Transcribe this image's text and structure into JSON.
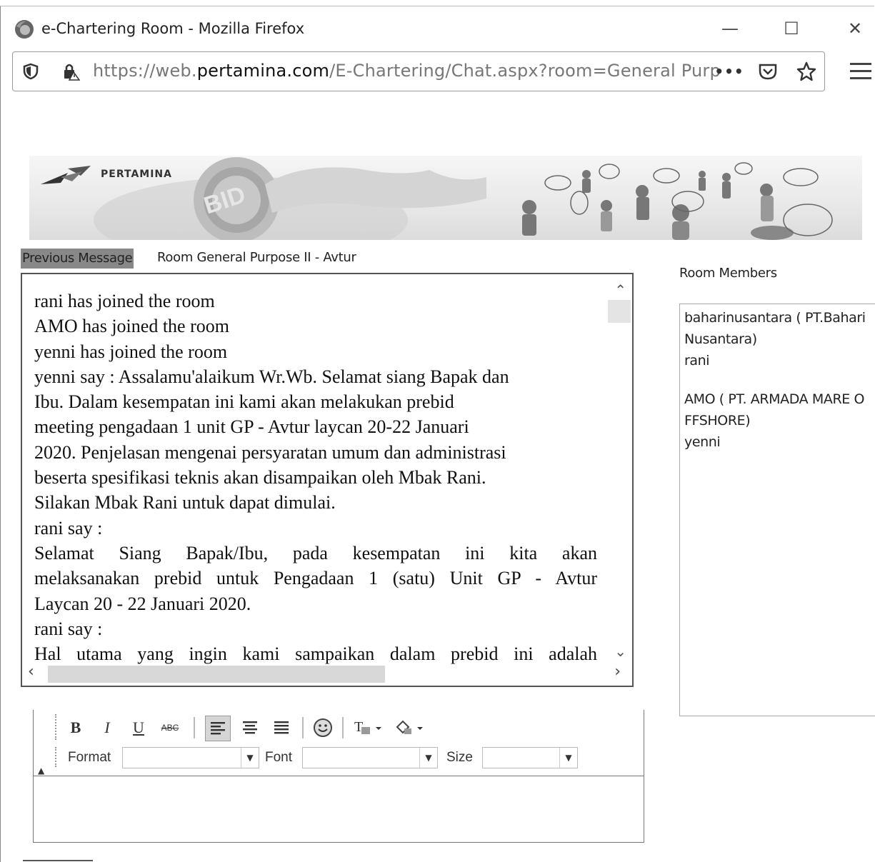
{
  "window": {
    "title": "e-Chartering Room - Mozilla Firefox",
    "minimize": "—",
    "maximize": "☐",
    "close": "✕"
  },
  "urlbar": {
    "prefix": "https://web.",
    "domain": "pertamina.com",
    "path": "/E-Chartering/Chat.aspx?room=General Purpose"
  },
  "banner": {
    "brand": "PERTAMINA",
    "overlay": "BID"
  },
  "header": {
    "previous_message": "Previous Message",
    "room_title": "Room General Purpose II - Avtur",
    "members_title": "Room Members"
  },
  "chat": {
    "lines": [
      "rani has joined the room",
      "AMO has joined the room",
      "yenni has joined the room",
      "yenni say : Assalamu'alaikum Wr.Wb. Selamat siang Bapak dan",
      "Ibu. Dalam kesempatan ini kami akan melakukan prebid",
      "meeting pengadaan 1 unit GP - Avtur laycan 20-22 Januari",
      "2020. Penjelasan mengenai persyaratan umum dan administrasi",
      "beserta spesifikasi teknis akan disampaikan oleh Mbak Rani.",
      "Silakan Mbak Rani untuk dapat dimulai.",
      "rani say :",
      "Selamat Siang Bapak/Ibu, pada kesempatan ini kita akan",
      "melaksanakan prebid untuk Pengadaan 1 (satu) Unit GP - Avtur",
      "Laycan 20 - 22 Januari 2020.",
      "rani say :",
      "Hal utama yang ingin kami sampaikan dalam prebid ini adalah"
    ]
  },
  "members": [
    "baharinusantara ( PT.Bahari Nusantara)",
    "rani",
    "AMO ( PT. ARMADA MARE OFFSHORE)",
    "yenni"
  ],
  "editor": {
    "bold": "B",
    "italic": "I",
    "underline": "U",
    "strike": "ABC",
    "format_label": "Format",
    "font_label": "Font",
    "size_label": "Size",
    "format_value": "",
    "font_value": "",
    "size_value": ""
  }
}
